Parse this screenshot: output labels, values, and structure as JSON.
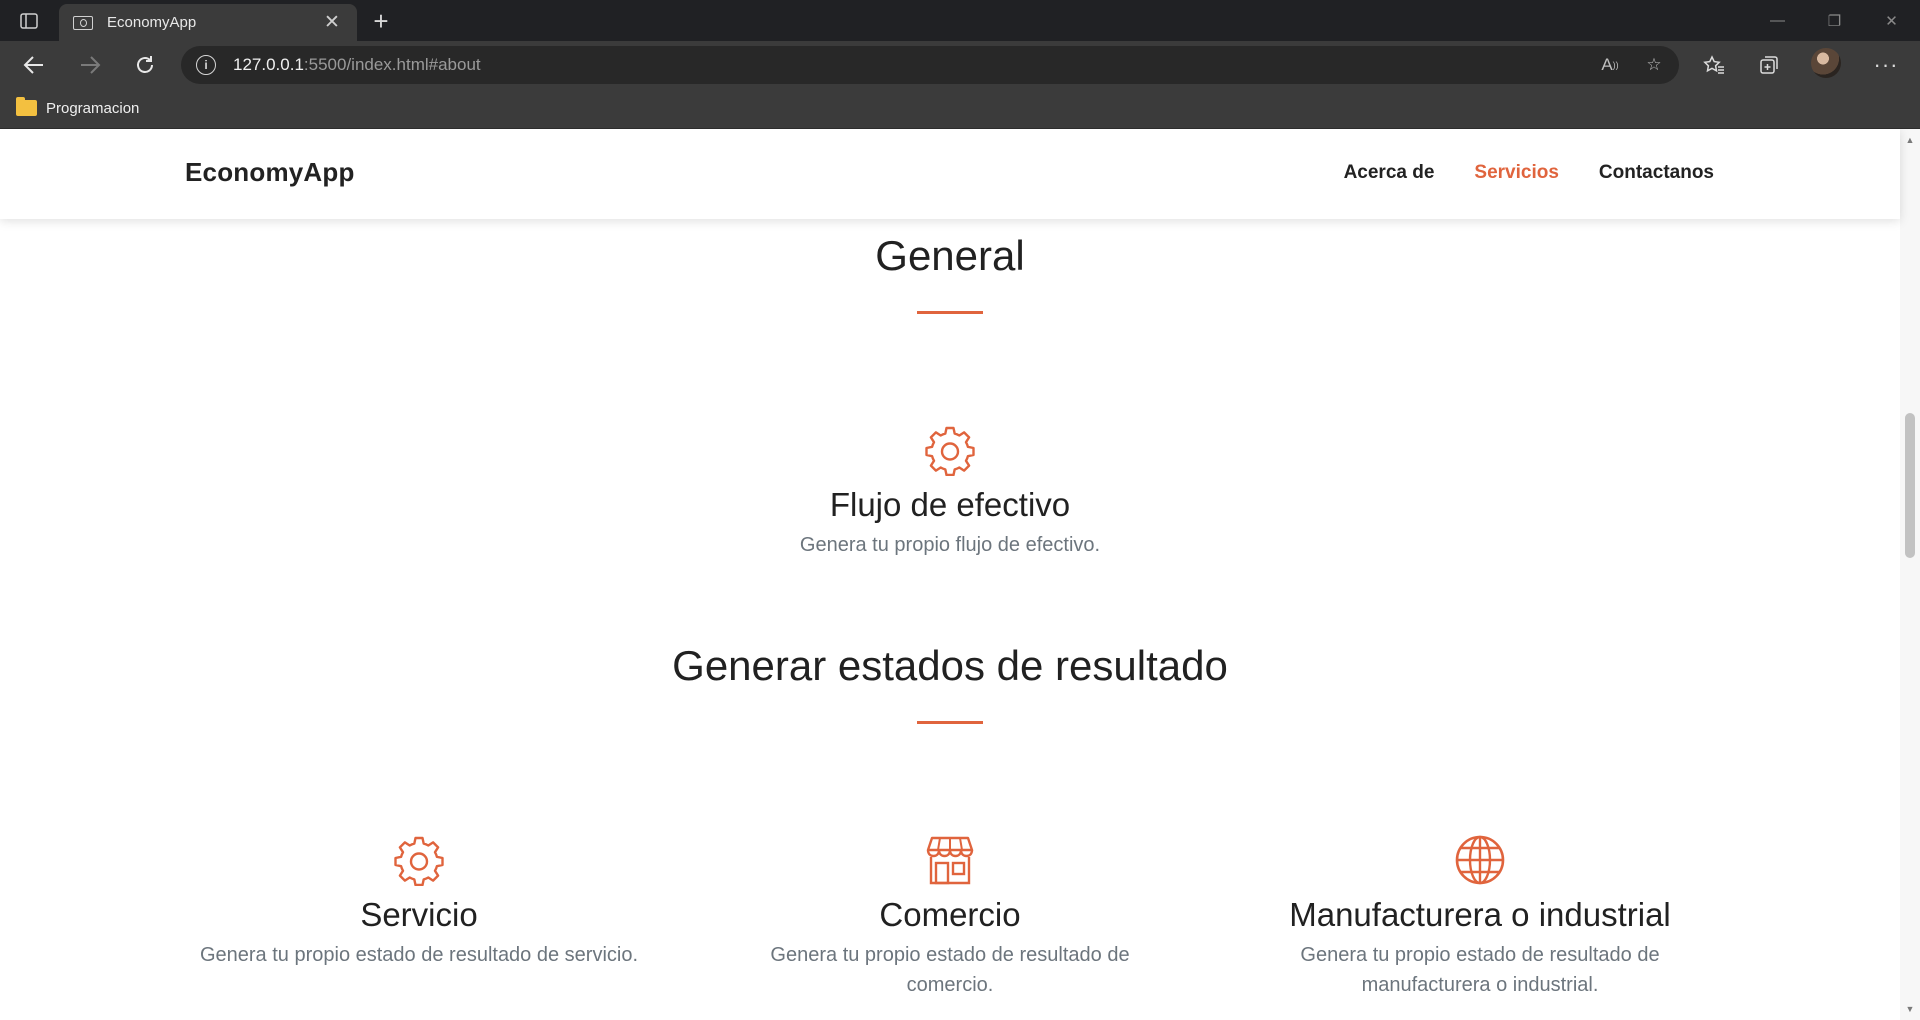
{
  "browser": {
    "tab_title": "EconomyApp",
    "url_host": "127.0.0.1",
    "url_rest": ":5500/index.html#about",
    "bookmark_folder": "Programacion",
    "window_controls": [
      "—",
      "❐",
      "✕"
    ]
  },
  "site": {
    "brand": "EconomyApp",
    "nav": [
      {
        "label": "Acerca de",
        "active": false
      },
      {
        "label": "Servicios",
        "active": true
      },
      {
        "label": "Contactanos",
        "active": false
      }
    ],
    "accent_color": "#e0643d"
  },
  "sections": {
    "general": {
      "title": "General",
      "items": [
        {
          "icon": "gear-icon",
          "title": "Flujo de efectivo",
          "desc": "Genera tu propio flujo de efectivo."
        }
      ]
    },
    "results": {
      "title": "Generar estados de resultado",
      "items": [
        {
          "icon": "gear-icon",
          "title": "Servicio",
          "desc": "Genera tu propio estado de resultado de servicio."
        },
        {
          "icon": "shop-icon",
          "title": "Comercio",
          "desc": "Genera tu propio estado de resultado de comercio."
        },
        {
          "icon": "globe-icon",
          "title": "Manufacturera o industrial",
          "desc": "Genera tu propio estado de resultado de manufacturera o industrial."
        }
      ]
    }
  }
}
